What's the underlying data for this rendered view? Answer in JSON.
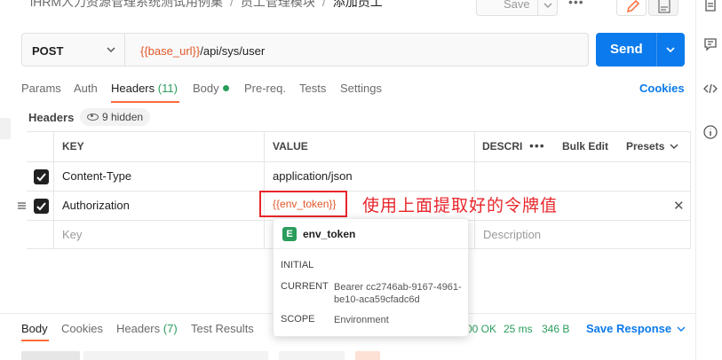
{
  "breadcrumb": {
    "collection": "iHRM人力资源管理系统测试用例集",
    "folder": "员工管理模块",
    "request": "添加员工"
  },
  "toolbar": {
    "save_label": "Save",
    "more_label": "•••"
  },
  "request": {
    "method": "POST",
    "url_var": "{{base_url}}",
    "url_path": "/api/sys/user",
    "send_label": "Send"
  },
  "tabs": [
    {
      "label": "Params"
    },
    {
      "label": "Auth"
    },
    {
      "label": "Headers",
      "count": "(11)"
    },
    {
      "label": "Body"
    },
    {
      "label": "Pre-req."
    },
    {
      "label": "Tests"
    },
    {
      "label": "Settings"
    }
  ],
  "cookies_label": "Cookies",
  "headers_sub": {
    "label": "Headers",
    "hidden": "9 hidden"
  },
  "table": {
    "columns": {
      "key": "KEY",
      "value": "VALUE",
      "description": "DESCRI",
      "more": "•••",
      "bulk_edit": "Bulk Edit",
      "presets": "Presets"
    },
    "rows": [
      {
        "key": "Content-Type",
        "value": "application/json"
      },
      {
        "key": "Authorization",
        "value": "{{env_token}}"
      }
    ],
    "placeholder": {
      "key": "Key",
      "description": "Description"
    }
  },
  "annotation": "使用上面提取好的令牌值",
  "popup": {
    "badge": "E",
    "name": "env_token",
    "initial_label": "INITIAL",
    "current_label": "CURRENT",
    "current_value": "Bearer cc2746ab-9167-4961-be10-aca59cfadc6d",
    "scope_label": "SCOPE",
    "scope_value": "Environment"
  },
  "response": {
    "tabs": [
      {
        "label": "Body"
      },
      {
        "label": "Cookies"
      },
      {
        "label": "Headers",
        "count": "(7)"
      },
      {
        "label": "Test Results"
      }
    ],
    "status": "00 OK",
    "time": "25 ms",
    "size": "346 B",
    "save_label": "Save Response"
  },
  "colors": {
    "accent": "#0a7aec",
    "tab_active": "#ff6c37",
    "variable": "#e0582a",
    "highlight": "#e8262b",
    "success": "#2a9d5c"
  },
  "icons": [
    "chevron-down-icon",
    "pencil-icon",
    "document-icon",
    "comment-icon",
    "code-icon",
    "info-icon",
    "check-icon",
    "drag-handle-icon",
    "close-icon",
    "eye-icon"
  ]
}
